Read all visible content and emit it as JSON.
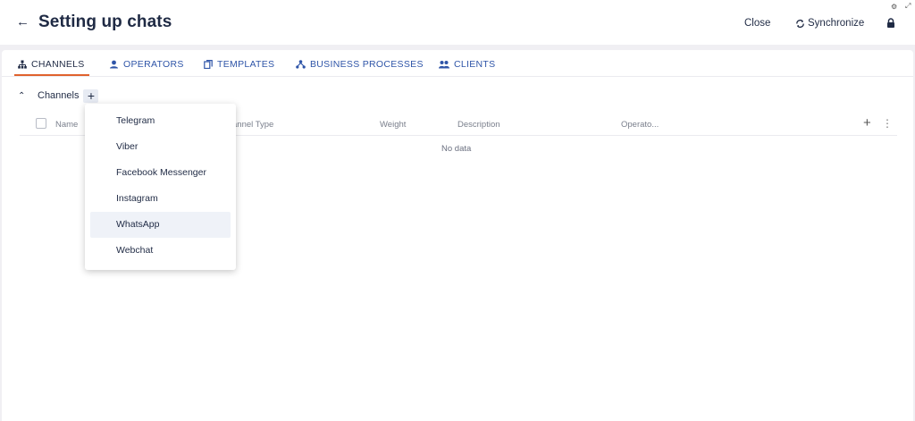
{
  "header": {
    "title": "Setting up chats",
    "close_label": "Close",
    "sync_label": "Synchronize"
  },
  "tabs": [
    {
      "label": "CHANNELS",
      "active": true
    },
    {
      "label": "OPERATORS",
      "active": false
    },
    {
      "label": "TEMPLATES",
      "active": false
    },
    {
      "label": "BUSINESS PROCESSES",
      "active": false
    },
    {
      "label": "CLIENTS",
      "active": false
    }
  ],
  "section": {
    "label": "Channels"
  },
  "table": {
    "columns": [
      "Name",
      "annel Type",
      "Weight",
      "Description",
      "Operato..."
    ],
    "empty_text": "No data"
  },
  "dropdown": {
    "items": [
      "Telegram",
      "Viber",
      "Facebook Messenger",
      "Instagram",
      "WhatsApp",
      "Webchat"
    ],
    "highlighted": "WhatsApp"
  },
  "colors": {
    "accent": "#e0622d",
    "tab_text": "#2f55a8",
    "title": "#1f2a44"
  }
}
